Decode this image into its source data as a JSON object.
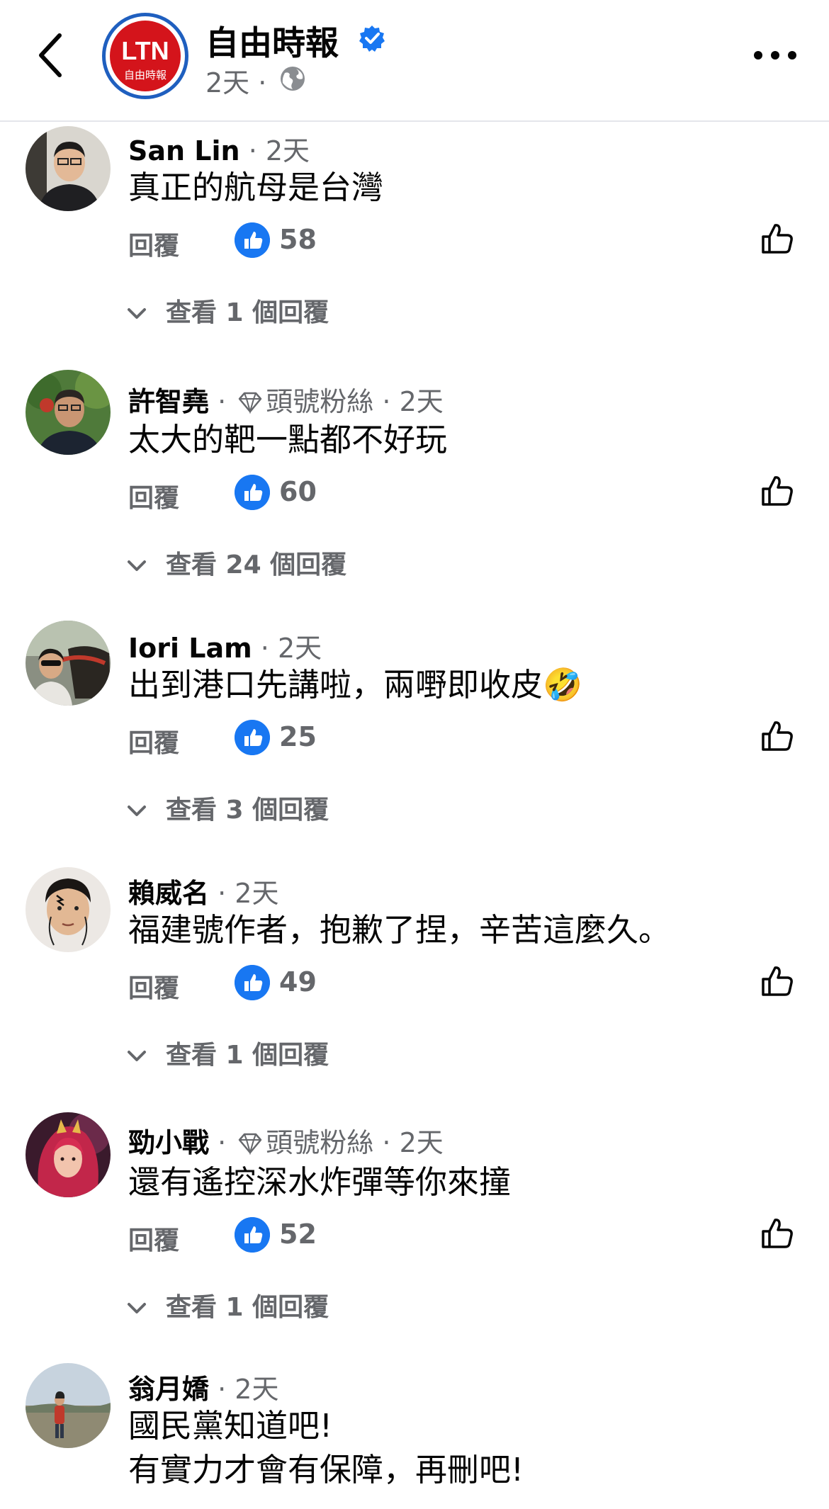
{
  "header": {
    "page_name": "自由時報",
    "post_time": "2天",
    "meta_sep": "·",
    "logo_text": "LTN",
    "logo_subtext": "自由時報"
  },
  "colors": {
    "accent": "#1877f2",
    "muted": "#65676b",
    "text": "#050505",
    "logo_red": "#d4141b",
    "logo_ring": "#1f5fbf"
  },
  "comments": [
    {
      "author": "San Lin",
      "badge": "",
      "time": "2天",
      "text": [
        "真正的航母是台灣"
      ],
      "reply_label": "回覆",
      "likes": "58",
      "view_replies": "查看 1 個回覆"
    },
    {
      "author": "許智堯",
      "badge": "頭號粉絲",
      "time": "2天",
      "text": [
        "太大的靶一點都不好玩"
      ],
      "reply_label": "回覆",
      "likes": "60",
      "view_replies": "查看 24 個回覆"
    },
    {
      "author": "Iori Lam",
      "badge": "",
      "time": "2天",
      "text": [
        "出到港口先講啦，兩嘢即收皮🤣"
      ],
      "reply_label": "回覆",
      "likes": "25",
      "view_replies": "查看 3 個回覆"
    },
    {
      "author": "賴威名",
      "badge": "",
      "time": "2天",
      "text": [
        "福建號作者，抱歉了捏，辛苦這麼久。"
      ],
      "reply_label": "回覆",
      "likes": "49",
      "view_replies": "查看 1 個回覆"
    },
    {
      "author": "勁小戰",
      "badge": "頭號粉絲",
      "time": "2天",
      "text": [
        "還有遙控深水炸彈等你來撞"
      ],
      "reply_label": "回覆",
      "likes": "52",
      "view_replies": "查看 1 個回覆"
    },
    {
      "author": "翁月嬌",
      "badge": "",
      "time": "2天",
      "text": [
        "國民黨知道吧!",
        "有實力才會有保障，再刪吧!"
      ]
    }
  ],
  "icons": [
    "back-arrow-icon",
    "verified-badge-icon",
    "globe-icon",
    "more-options-icon",
    "diamond-icon",
    "like-thumb-icon",
    "chevron-down-icon"
  ]
}
